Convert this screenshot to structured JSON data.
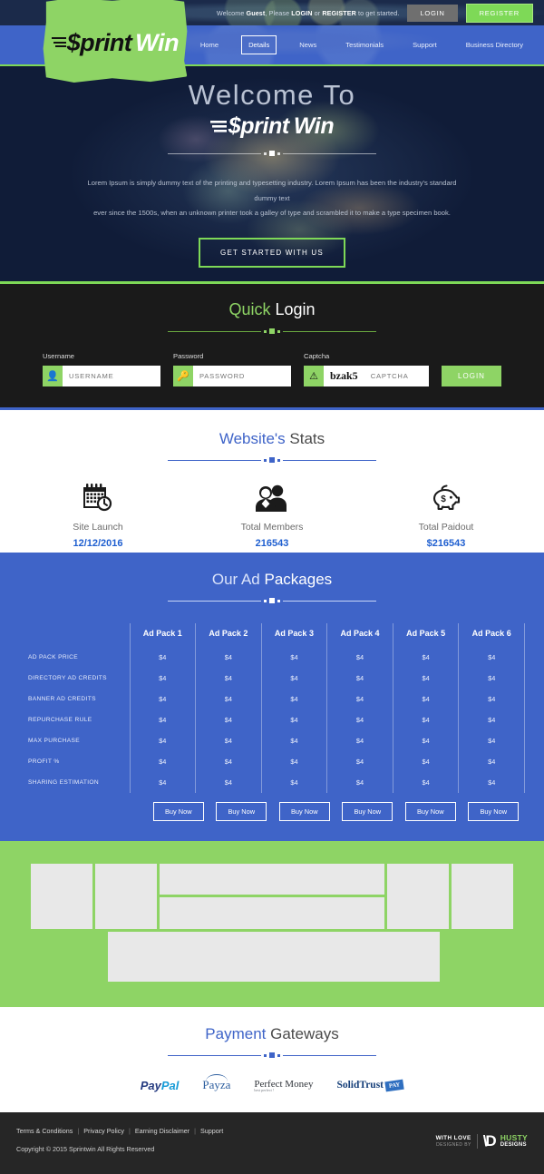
{
  "topbar": {
    "welcome_prefix": "Welcome ",
    "welcome_guest": "Guest",
    "welcome_mid": ", Please ",
    "welcome_login": "LOGIN",
    "welcome_or": " or ",
    "welcome_register": "REGISTER",
    "welcome_suffix": " to get started.",
    "login_button": "LOGIN",
    "register_button": "REGISTER",
    "login_bg": "#6f6f6f",
    "register_bg": "#7ed957"
  },
  "logo": {
    "bars_icon": "menu-bars-icon",
    "sprint": "$print",
    "win": "Win",
    "blob_color": "#8ed465"
  },
  "nav": {
    "items": [
      {
        "label": "Home",
        "active": false
      },
      {
        "label": "Details",
        "active": true
      },
      {
        "label": "News",
        "active": false
      },
      {
        "label": "Testimonials",
        "active": false
      },
      {
        "label": "Support",
        "active": false
      },
      {
        "label": "Business Directory",
        "active": false
      }
    ]
  },
  "hero": {
    "welcome": "Welcome To",
    "brand_sprint": "$print",
    "brand_win": "Win",
    "paragraph_line1": "Lorem Ipsum is simply dummy text of the printing and typesetting industry. Lorem Ipsum has been the industry's standard dummy text",
    "paragraph_line2": "ever since the 1500s, when an unknown printer took a galley of type and scrambled it to make a type specimen book.",
    "cta": "GET STARTED WITH US"
  },
  "quick_login": {
    "title_accent": "Quick",
    "title_rest": " Login",
    "username_label": "Username",
    "username_placeholder": "USERNAME",
    "username_icon": "user-icon",
    "password_label": "Password",
    "password_placeholder": "PASSWORD",
    "password_icon": "key-icon",
    "captcha_label": "Captcha",
    "captcha_code": "bzak5",
    "captcha_placeholder": "CAPTCHA",
    "captcha_icon": "refresh-icon",
    "login_button": "LOGIN",
    "accent_color": "#8ed465"
  },
  "stats": {
    "title_accent": "Website's",
    "title_rest": " Stats",
    "items": [
      {
        "icon": "calendar-clock-icon",
        "label": "Site Launch",
        "value": "12/12/2016"
      },
      {
        "icon": "people-icon",
        "label": "Total Members",
        "value": "216543"
      },
      {
        "icon": "piggy-bank-icon",
        "label": "Total Paidout",
        "value": "$216543"
      }
    ],
    "value_color": "#1f5fd0"
  },
  "packages": {
    "title_accent": "Our Ad",
    "title_rest": " Packages",
    "columns": [
      "Ad Pack 1",
      "Ad Pack 2",
      "Ad Pack 3",
      "Ad Pack 4",
      "Ad Pack 5",
      "Ad Pack 6"
    ],
    "rows": [
      {
        "label": "AD PACK PRICE",
        "values": [
          "$4",
          "$4",
          "$4",
          "$4",
          "$4",
          "$4"
        ]
      },
      {
        "label": "DIRECTORY AD CREDITS",
        "values": [
          "$4",
          "$4",
          "$4",
          "$4",
          "$4",
          "$4"
        ]
      },
      {
        "label": "BANNER AD CREDITS",
        "values": [
          "$4",
          "$4",
          "$4",
          "$4",
          "$4",
          "$4"
        ]
      },
      {
        "label": "REPURCHASE RULE",
        "values": [
          "$4",
          "$4",
          "$4",
          "$4",
          "$4",
          "$4"
        ]
      },
      {
        "label": "MAX PURCHASE",
        "values": [
          "$4",
          "$4",
          "$4",
          "$4",
          "$4",
          "$4"
        ]
      },
      {
        "label": "PROFIT %",
        "values": [
          "$4",
          "$4",
          "$4",
          "$4",
          "$4",
          "$4"
        ]
      },
      {
        "label": "SHARING ESTIMATION",
        "values": [
          "$4",
          "$4",
          "$4",
          "$4",
          "$4",
          "$4"
        ]
      }
    ],
    "buy_label": "Buy Now",
    "bg_color": "#3f64c8"
  },
  "green_band": {
    "bg_color": "#8ed465",
    "placeholder_color": "#e8e8e8"
  },
  "gateways": {
    "title_accent": "Payment",
    "title_rest": " Gateways",
    "items": [
      {
        "name": "PayPal",
        "part1": "Pay",
        "part2": "Pal"
      },
      {
        "name": "Payza"
      },
      {
        "name": "Perfect Money",
        "sub": "best perfect !"
      },
      {
        "name": "SolidTrust",
        "tag": "PAY"
      }
    ]
  },
  "footer": {
    "links": [
      "Terms & Conditions",
      "Privacy Policy",
      "Earning Disclaimer",
      "Support"
    ],
    "copyright": "Copyright © 2015 Sprintwin All Rights Reserved",
    "with_love": "WITH LOVE",
    "designed_by": "DESIGNED BY",
    "brand_mark": "\\D",
    "brand_name1": "HUSTY",
    "brand_name2": "DESIGNS"
  }
}
